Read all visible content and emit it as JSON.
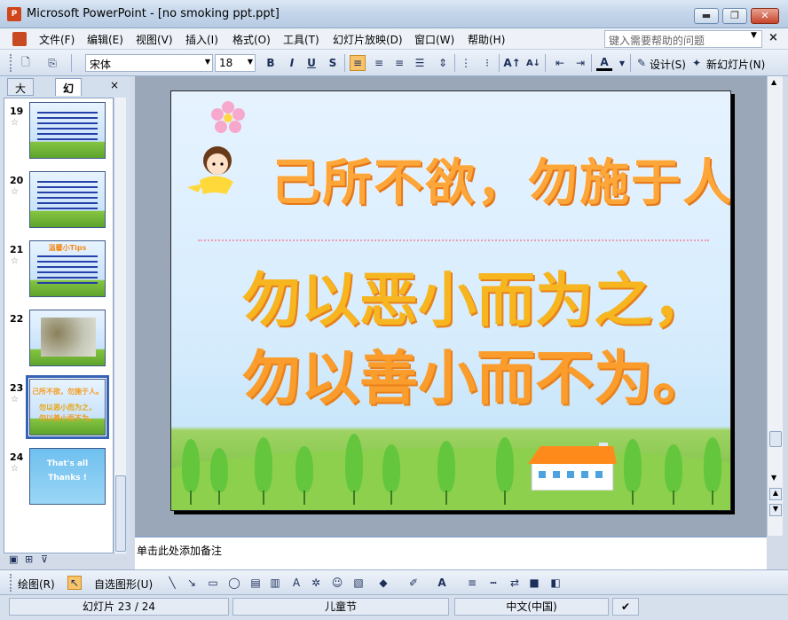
{
  "window": {
    "title": "Microsoft PowerPoint - [no smoking ppt.ppt]",
    "min_label": "▬",
    "max_label": "❐",
    "close_label": "✕"
  },
  "menu": {
    "items": [
      "文件(F)",
      "编辑(E)",
      "视图(V)",
      "插入(I)",
      "格式(O)",
      "工具(T)",
      "幻灯片放映(D)",
      "窗口(W)",
      "帮助(H)"
    ],
    "help_placeholder": "键入需要帮助的问题"
  },
  "toolbar": {
    "font_name": "宋体",
    "font_size": "18",
    "bold": "B",
    "italic": "I",
    "underline": "U",
    "shadow": "S",
    "design_label": "设计(S)",
    "new_slide_label": "新幻灯片(N)"
  },
  "left_panel": {
    "tabs": [
      "大纲",
      "幻灯片"
    ],
    "active_tab": "幻灯片",
    "thumbnails": [
      {
        "num": "19",
        "kind": "text"
      },
      {
        "num": "20",
        "kind": "text"
      },
      {
        "num": "21",
        "kind": "tips",
        "title": "温馨小Tips"
      },
      {
        "num": "22",
        "kind": "photo"
      },
      {
        "num": "23",
        "kind": "current",
        "lines": [
          "己所不欲，勿施于人。",
          "勿以恶小而为之，",
          "勿以善小而不为。"
        ]
      },
      {
        "num": "24",
        "kind": "thanks",
        "lines": [
          "That's all",
          "Thanks !"
        ]
      }
    ]
  },
  "slide": {
    "title": "己所不欲，勿施于人。",
    "body": [
      "勿以恶小而为之，",
      "勿以善小而不为。"
    ]
  },
  "notes": {
    "placeholder": "单击此处添加备注"
  },
  "drawbar": {
    "draw_label": "绘图(R)",
    "autoshape_label": "自选图形(U)"
  },
  "status": {
    "slide_position": "幻灯片 23 / 24",
    "design_name": "儿童节",
    "language": "中文(中国)"
  },
  "colors": {
    "title_orange": "#fda63a",
    "body_yellow": "#f7b51f",
    "accent_blue": "#3563b6"
  }
}
